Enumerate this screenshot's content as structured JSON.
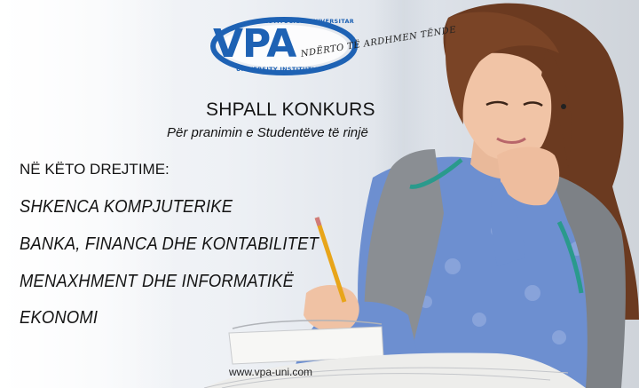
{
  "logo": {
    "main": "VPA",
    "top_text": "INSTITUCION UNIVERSITAR",
    "bottom_text": "UNIVERSITY INSTITUTION",
    "tagline": "NDËRTO TË ARDHMEN TËNDE",
    "colors": {
      "blue": "#1e62b4"
    }
  },
  "headline": "SHPALL KONKURS",
  "subheadline": "Për pranimin e Studentëve të rinjë",
  "intro": "NË KËTO DREJTIME:",
  "programs": [
    "SHKENCA KOMPJUTERIKE",
    "BANKA, FINANCA DHE KONTABILITET",
    "MENAXHMENT DHE INFORMATIKË",
    "EKONOMI"
  ],
  "website": "www.vpa-uni.com"
}
